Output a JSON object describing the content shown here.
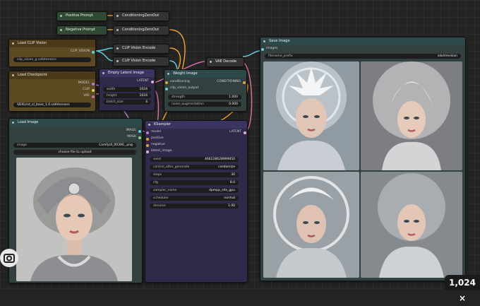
{
  "nodes": {
    "positive_prompt": {
      "title": "Positive Prompt"
    },
    "negative_prompt": {
      "title": "Negative Prompt"
    },
    "cond_zero_out_1": {
      "title": "ConditioningZeroOut"
    },
    "cond_zero_out_2": {
      "title": "ConditioningZeroOut"
    },
    "load_clip_vision": {
      "title": "Load CLIP Vision",
      "output": "CLIP_VISION",
      "widget_value": "clip_vision_g.safetensors"
    },
    "clip_vision_encode_1": {
      "title": "CLIP Vision Encode"
    },
    "clip_vision_encode_2": {
      "title": "CLIP Vision Encode"
    },
    "vae_decode": {
      "title": "VAE Decode"
    },
    "load_checkpoint": {
      "title": "Load Checkpoint",
      "outputs": [
        "MODEL",
        "CLIP",
        "VAE"
      ],
      "widget_value": "SDXL/sd_xl_base_1.0.safetensors"
    },
    "empty_latent": {
      "title": "Empty Latent Image",
      "output": "LATENT",
      "widgets": [
        {
          "label": "width",
          "value": "1024"
        },
        {
          "label": "height",
          "value": "1024"
        },
        {
          "label": "batch_size",
          "value": "4"
        }
      ]
    },
    "weight_image": {
      "title": "Weight Image",
      "input": "conditioning",
      "output": "CONDITIONING",
      "input2": "clip_vision_output",
      "widgets": [
        {
          "label": "strength",
          "value": "1.000"
        },
        {
          "label": "noise_augmentation",
          "value": "0.000"
        }
      ]
    },
    "load_image": {
      "title": "Load Image",
      "outputs": [
        "IMAGE",
        "MASK"
      ],
      "widget_label": "image",
      "widget_value": "ComfyUI_00390_.png",
      "upload_label": "choose file to upload"
    },
    "ksampler": {
      "title": "KSampler",
      "output": "LATENT",
      "inputs": [
        "model",
        "positive",
        "negative",
        "latent_image"
      ],
      "widgets": [
        {
          "label": "seed",
          "value": "466228628999850"
        },
        {
          "label": "control_after_generate",
          "value": "randomize"
        },
        {
          "label": "steps",
          "value": "30"
        },
        {
          "label": "cfg",
          "value": "8.0"
        },
        {
          "label": "sampler_name",
          "value": "dpmpp_sde_gpu"
        },
        {
          "label": "scheduler",
          "value": "normal"
        },
        {
          "label": "denoise",
          "value": "1.00"
        }
      ]
    },
    "save_image": {
      "title": "Save Image",
      "input": "images",
      "widget_label": "filename_prefix",
      "widget_value": "sdxl/revision"
    }
  },
  "overlay": {
    "zoom_badge": "1,024 ×"
  },
  "colors": {
    "accent_wire_cyan": "#63d0e0",
    "wire_orange": "#e8a13a",
    "wire_pink": "#d46fa4",
    "wire_purple": "#9b7fd4"
  }
}
